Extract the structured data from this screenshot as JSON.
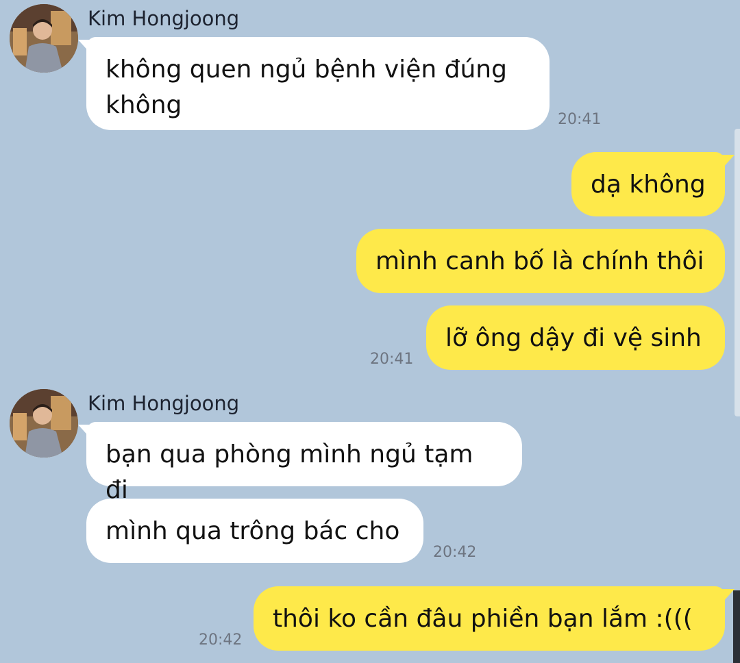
{
  "conversation": {
    "contact": {
      "name": "Kim Hongjoong",
      "avatar_icon": "profile-photo-icon"
    },
    "messages": [
      {
        "from": "contact",
        "text": "không quen ngủ bệnh viện đúng không",
        "time": "20:41"
      },
      {
        "from": "me",
        "text": "dạ không"
      },
      {
        "from": "me",
        "text": "mình canh bố là chính thôi"
      },
      {
        "from": "me",
        "text": "lỡ ông dậy đi vệ sinh",
        "time": "20:41"
      },
      {
        "from": "contact",
        "text": "bạn qua phòng mình ngủ tạm đi"
      },
      {
        "from": "contact",
        "text": "mình qua trông bác cho",
        "time": "20:42"
      },
      {
        "from": "me",
        "text": "thôi ko cần đâu phiền bạn lắm :(((",
        "time": "20:42"
      }
    ]
  },
  "theme": {
    "background": "#b1c6da",
    "incoming_bubble": "#ffffff",
    "outgoing_bubble": "#fee94a"
  }
}
